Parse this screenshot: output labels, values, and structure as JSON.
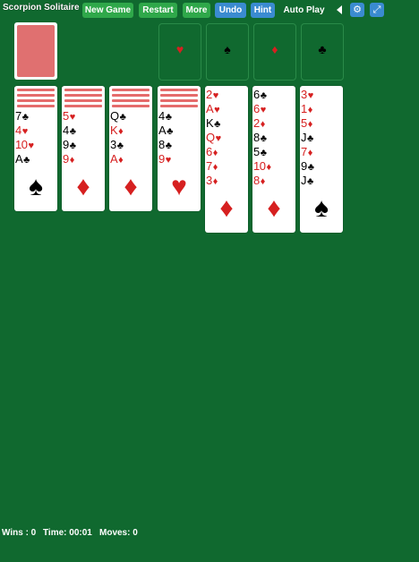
{
  "title": "Scorpion Solitaire",
  "toolbar": {
    "new_game": "New Game",
    "restart": "Restart",
    "more": "More",
    "undo": "Undo",
    "hint": "Hint",
    "auto_play": "Auto Play"
  },
  "foundations": [
    {
      "suit": "♥",
      "color": "red"
    },
    {
      "suit": "♠",
      "color": "black"
    },
    {
      "suit": "♦",
      "color": "red"
    },
    {
      "suit": "♣",
      "color": "black"
    }
  ],
  "tableau": [
    {
      "down": 4,
      "cards": [
        [
          "7",
          "♣"
        ],
        [
          "4",
          "♥"
        ],
        [
          "10",
          "♥"
        ],
        [
          "A",
          "♣"
        ]
      ],
      "big": "♠",
      "big_color": "black"
    },
    {
      "down": 4,
      "cards": [
        [
          "5",
          "♥"
        ],
        [
          "4",
          "♣"
        ],
        [
          "9",
          "♣"
        ],
        [
          "9",
          "♦"
        ]
      ],
      "big": "♦",
      "big_color": "red"
    },
    {
      "down": 4,
      "cards": [
        [
          "Q",
          "♣"
        ],
        [
          "K",
          "♦"
        ],
        [
          "3",
          "♣"
        ],
        [
          "A",
          "♦"
        ]
      ],
      "big": "♦",
      "big_color": "red"
    },
    {
      "down": 4,
      "cards": [
        [
          "4",
          "♣"
        ],
        [
          "A",
          "♣"
        ],
        [
          "8",
          "♣"
        ],
        [
          "9",
          "♥"
        ]
      ],
      "big": "♥",
      "big_color": "red"
    },
    {
      "down": 0,
      "cards": [
        [
          "2",
          "♥"
        ],
        [
          "A",
          "♥"
        ],
        [
          "K",
          "♣"
        ],
        [
          "Q",
          "♥"
        ],
        [
          "6",
          "♦"
        ],
        [
          "7",
          "♦"
        ],
        [
          "3",
          "♦"
        ]
      ],
      "big": "♦",
      "big_color": "red"
    },
    {
      "down": 0,
      "cards": [
        [
          "6",
          "♣"
        ],
        [
          "6",
          "♥"
        ],
        [
          "2",
          "♦"
        ],
        [
          "8",
          "♣"
        ],
        [
          "5",
          "♣"
        ],
        [
          "10",
          "♦"
        ],
        [
          "8",
          "♦"
        ]
      ],
      "big": "♦",
      "big_color": "red"
    },
    {
      "down": 0,
      "cards": [
        [
          "3",
          "♥"
        ],
        [
          "1",
          "♦"
        ],
        [
          "5",
          "♦"
        ],
        [
          "J",
          "♣"
        ],
        [
          "7",
          "♦"
        ],
        [
          "9",
          "♣"
        ],
        [
          "J",
          "♣"
        ]
      ],
      "big": "♠",
      "big_color": "black"
    }
  ],
  "status": {
    "wins": "Wins : 0",
    "time": "Time: 00:01",
    "moves": "Moves: 0"
  },
  "colors": {
    "background": "#10692f",
    "button_green": "#2fa84a",
    "button_blue": "#3a8bd0",
    "card_red": "#d62020"
  }
}
